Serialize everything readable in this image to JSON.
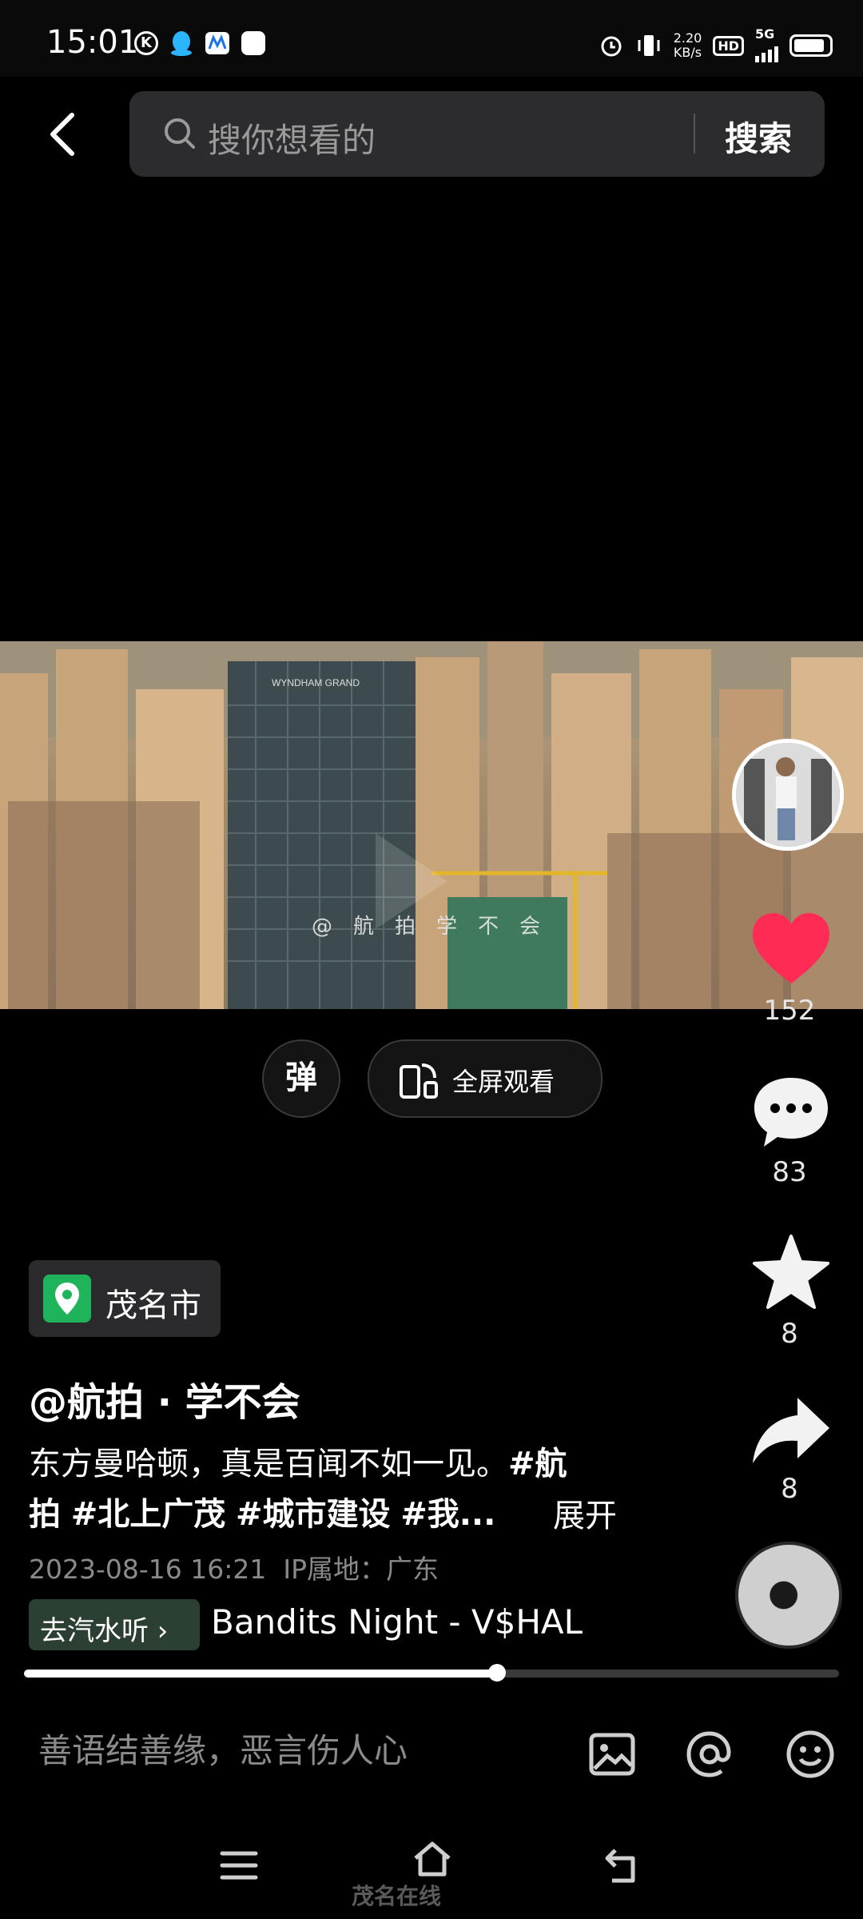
{
  "status_bar": {
    "time": "15:01",
    "net_speed_value": "2.20",
    "net_speed_unit": "KB/s",
    "hd_label": "HD",
    "network_label": "5G",
    "left_icons": [
      "k-badge-icon",
      "qq-icon",
      "app-icon",
      "square-icon"
    ],
    "right_icons": [
      "alarm-icon",
      "vibrate-icon",
      "hd-icon",
      "signal-icon",
      "battery-icon"
    ]
  },
  "header": {
    "back_icon": "chevron-left-icon",
    "search_placeholder": "搜你想看的",
    "search_button": "搜索"
  },
  "video": {
    "watermark": "@航拍学不会",
    "building_sign": "WYNDHAM GRAND"
  },
  "sidebar": {
    "like_count": "152",
    "comment_count": "83",
    "favorite_count": "8",
    "share_count": "8",
    "like_color": "#fe2c55"
  },
  "controls": {
    "danmaku_label": "弹",
    "fullscreen_label": "全屏观看"
  },
  "post": {
    "location": "茂名市",
    "author": "@航拍 · 学不会",
    "description_text": "东方曼哈顿，真是百闻不如一见。",
    "tag1": "#航",
    "line2_prefix": "拍",
    "tag2": "#北上广茂",
    "tag3": "#城市建设",
    "tag4": "#我...",
    "expand_label": "展开",
    "date": "2023-08-16 16:21",
    "ip_location": "IP属地：广东",
    "music_button": "去汽水听 ›",
    "music_title": "Bandits Night - V$HAL"
  },
  "progress": {
    "fraction": 0.58
  },
  "comment_bar": {
    "placeholder": "善语结善缘，恶言伤人心",
    "icons": [
      "image-icon",
      "at-icon",
      "emoji-icon"
    ]
  },
  "nav": {
    "icons": [
      "menu-icon",
      "home-icon",
      "back-icon"
    ],
    "watermark": "茂名在线"
  }
}
